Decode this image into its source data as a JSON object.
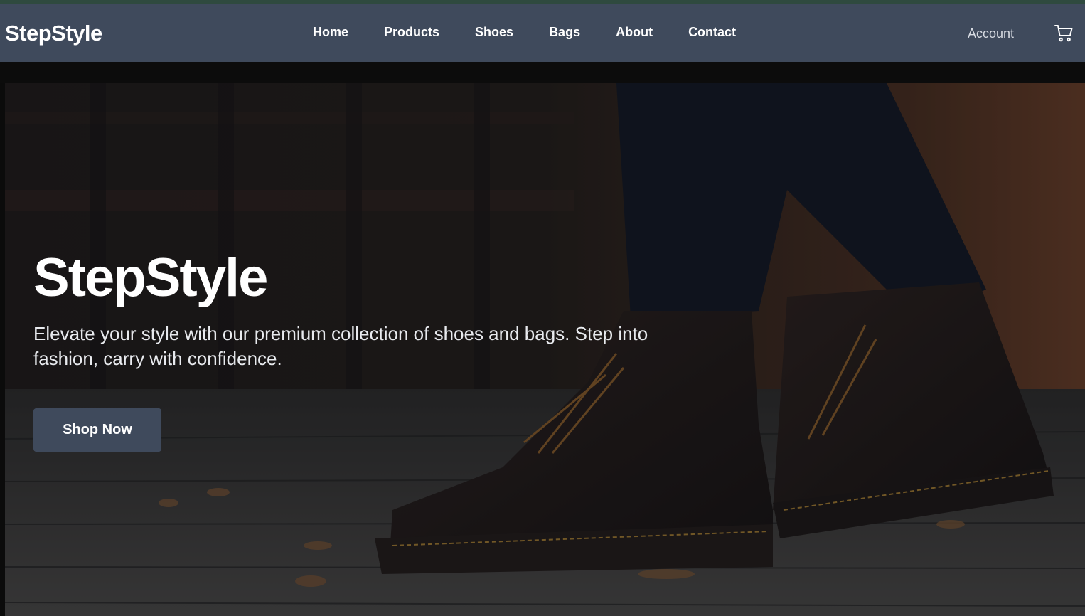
{
  "brand": {
    "name": "StepStyle"
  },
  "nav": {
    "items": [
      {
        "label": "Home"
      },
      {
        "label": "Products"
      },
      {
        "label": "Shoes"
      },
      {
        "label": "Bags"
      },
      {
        "label": "About"
      },
      {
        "label": "Contact"
      }
    ],
    "account_label": "Account",
    "cart_icon": "cart-icon"
  },
  "hero": {
    "title": "StepStyle",
    "subtitle": "Elevate your style with our premium collection of shoes and bags. Step into fashion, carry with confidence.",
    "cta_label": "Shop Now"
  },
  "colors": {
    "navbar_bg": "#3f4a5c",
    "button_bg": "#3f4a5c",
    "text_primary": "#ffffff"
  }
}
